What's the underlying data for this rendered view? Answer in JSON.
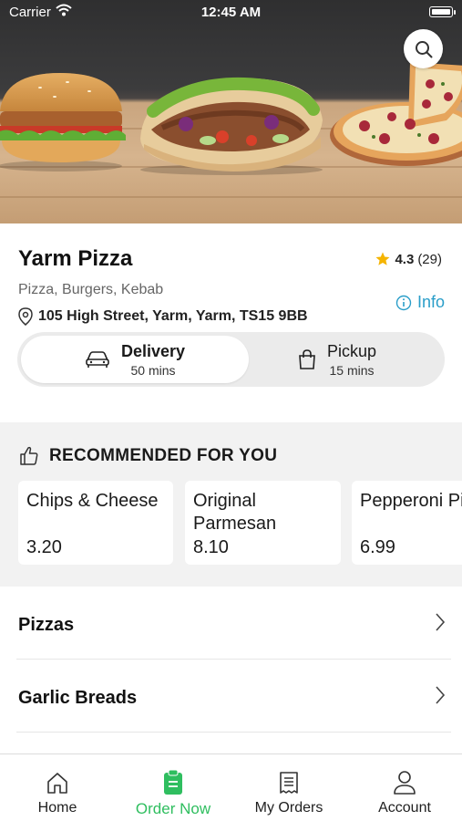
{
  "status_bar": {
    "carrier": "Carrier",
    "time": "12:45 AM"
  },
  "restaurant": {
    "name": "Yarm Pizza",
    "rating": "4.3",
    "review_count": "(29)",
    "cuisines": "Pizza, Burgers, Kebab",
    "info_label": "Info",
    "address": "105 High Street, Yarm, Yarm, TS15 9BB"
  },
  "order_type": {
    "selected": "Delivery",
    "delivery": {
      "label": "Delivery",
      "time": "50 mins"
    },
    "pickup": {
      "label": "Pickup",
      "time": "15 mins"
    }
  },
  "recommended": {
    "title": "RECOMMENDED FOR YOU",
    "items": [
      {
        "name": "Chips & Cheese",
        "price": "3.20"
      },
      {
        "name": "Original Parmesan",
        "price": "8.10"
      },
      {
        "name": "Pepperoni Pizza",
        "price": "6.99"
      }
    ]
  },
  "categories": [
    {
      "label": "Pizzas"
    },
    {
      "label": "Garlic Breads"
    }
  ],
  "tabbar": {
    "items": [
      {
        "label": "Home",
        "icon": "home-icon"
      },
      {
        "label": "Order Now",
        "icon": "order-now-icon"
      },
      {
        "label": "My Orders",
        "icon": "receipt-icon"
      },
      {
        "label": "Account",
        "icon": "person-icon"
      }
    ],
    "active": "Order Now"
  },
  "colors": {
    "accent_green": "#2fbe5f",
    "info_blue": "#2a9ec9",
    "star_yellow": "#f5b400",
    "section_gray": "#f2f2f2"
  }
}
